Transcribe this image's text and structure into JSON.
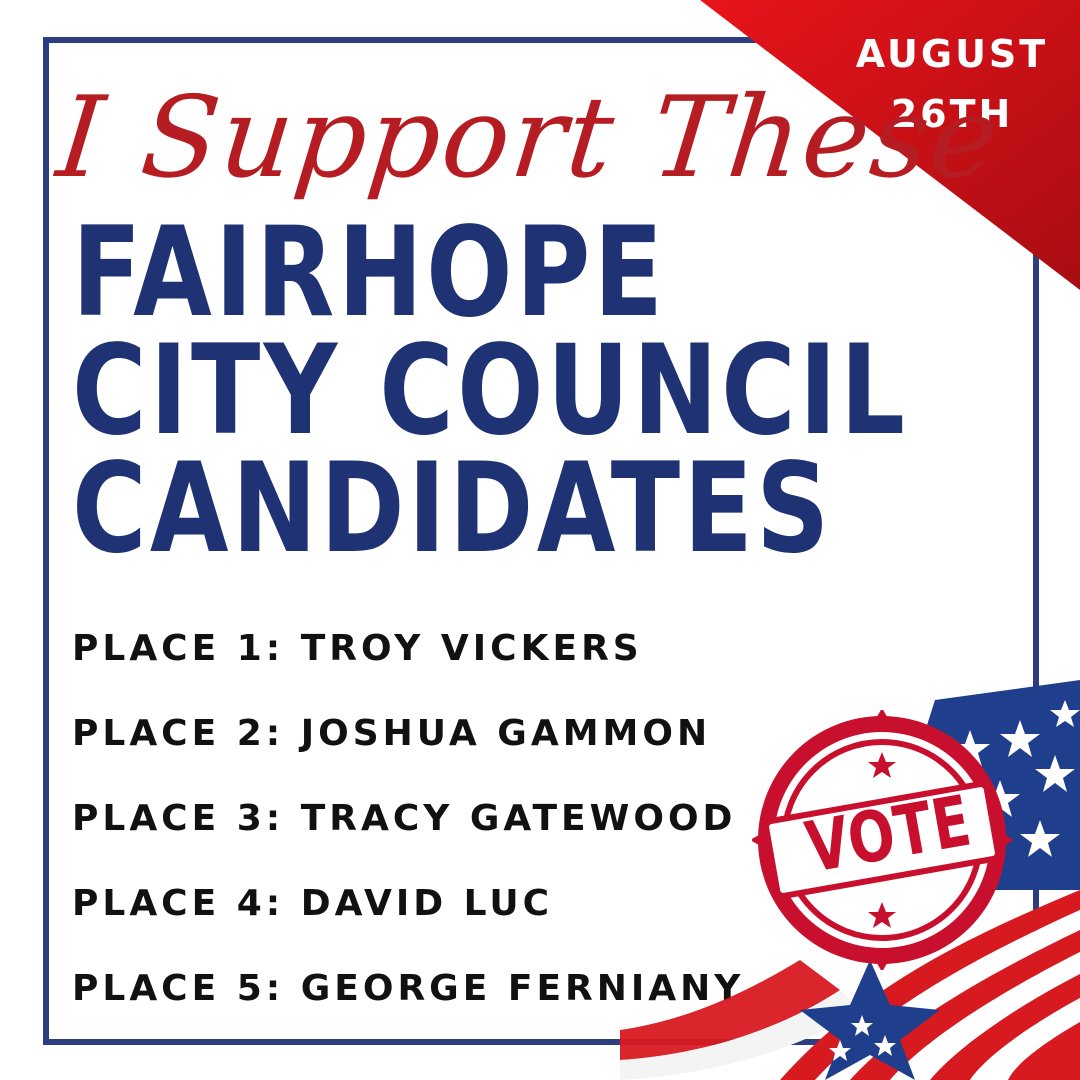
{
  "date": {
    "line1": "AUGUST",
    "line2": "26TH"
  },
  "script_title": "I Support These",
  "headline": {
    "line1": "FAIRHOPE",
    "line2": "CITY COUNCIL",
    "line3": "CANDIDATES"
  },
  "candidates": [
    "PLACE 1: TROY VICKERS",
    "PLACE 2: JOSHUA GAMMON",
    "PLACE 3: TRACY GATEWOOD",
    "PLACE 4: DAVID LUC",
    "PLACE 5: GEORGE FERNIANY"
  ],
  "stamp": {
    "label": "VOTE"
  },
  "colors": {
    "navy": "#1e3274",
    "red": "#c8102e",
    "script_red": "#b51d22",
    "frame": "#2c3e7f"
  },
  "icons": {
    "stamp": "vote-stamp-icon",
    "flag": "american-flag-icon",
    "stars": "star-icon"
  }
}
